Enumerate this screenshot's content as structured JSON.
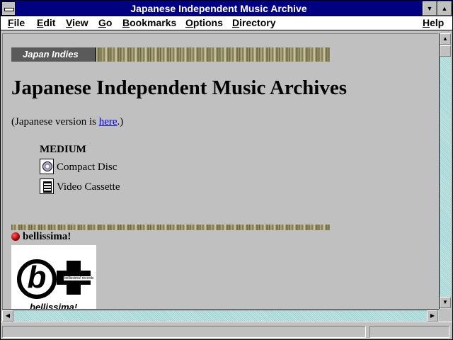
{
  "window": {
    "title": "Japanese Independent Music Archive"
  },
  "menubar": {
    "items": [
      {
        "accel": "F",
        "rest": "ile"
      },
      {
        "accel": "E",
        "rest": "dit"
      },
      {
        "accel": "V",
        "rest": "iew"
      },
      {
        "accel": "G",
        "rest": "o"
      },
      {
        "accel": "B",
        "rest": "ookmarks"
      },
      {
        "accel": "O",
        "rest": "ptions"
      },
      {
        "accel": "D",
        "rest": "irectory"
      },
      {
        "accel": "H",
        "rest": "elp"
      }
    ]
  },
  "page": {
    "banner_label": "Japan Indies",
    "heading": "Japanese Independent Music Archives",
    "intro_before": "(Japanese version is ",
    "intro_link": "here",
    "intro_after": ".)",
    "medium_title": "MEDIUM",
    "media": [
      {
        "label": "Compact Disc",
        "icon": "compact-disc-icon"
      },
      {
        "label": "Video Cassette",
        "icon": "video-cassette-icon"
      }
    ],
    "label_name": "bellissima!",
    "logo_small_text": "bellissima! records",
    "logo_word": "bellissima!"
  },
  "colors": {
    "title_bar": "#000080",
    "link": "#0000ee",
    "scroll_track": "#c8e8e8"
  }
}
